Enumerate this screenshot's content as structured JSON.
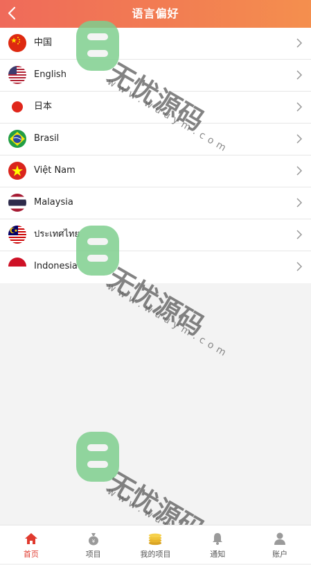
{
  "header": {
    "title": "语言偏好",
    "back_icon": "chevron-left-icon"
  },
  "languages": [
    {
      "label": "中国",
      "flag": "china"
    },
    {
      "label": "English",
      "flag": "usa"
    },
    {
      "label": "日本",
      "flag": "japan"
    },
    {
      "label": "Brasil",
      "flag": "brazil"
    },
    {
      "label": "Việt Nam",
      "flag": "vietnam"
    },
    {
      "label": "Malaysia",
      "flag": "thailand"
    },
    {
      "label": "ประเทศไทย",
      "flag": "malaysia"
    },
    {
      "label": "Indonesia",
      "flag": "indonesia"
    }
  ],
  "tabbar": {
    "tabs": [
      {
        "label": "首页",
        "icon": "home-icon",
        "active": true
      },
      {
        "label": "项目",
        "icon": "money-bag-icon",
        "active": false
      },
      {
        "label": "我的项目",
        "icon": "coins-icon",
        "active": false
      },
      {
        "label": "通知",
        "icon": "bell-icon",
        "active": false
      },
      {
        "label": "账户",
        "icon": "user-icon",
        "active": false
      }
    ]
  },
  "watermark": {
    "brand": "无忧源码",
    "url": "www.wuuym.com"
  },
  "colors": {
    "accent": "#e03a2e",
    "header_start": "#ef6a5a",
    "header_end": "#f48f4e",
    "watermark": "#7fcf8f"
  }
}
